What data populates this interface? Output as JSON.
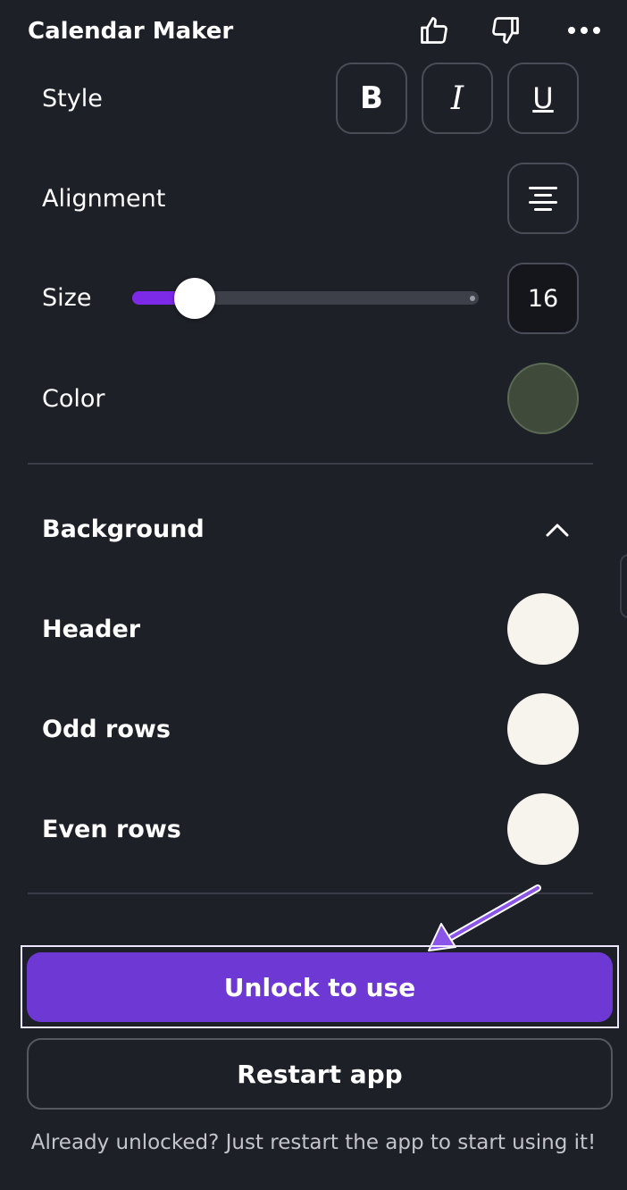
{
  "app": {
    "title": "Calendar Maker"
  },
  "header": {
    "icons": [
      "thumbs-up-icon",
      "thumbs-down-icon",
      "more-icon"
    ]
  },
  "text_settings": {
    "style_label": "Style",
    "style_buttons": {
      "bold": "B",
      "italic": "I",
      "underline": "U"
    },
    "alignment_label": "Alignment",
    "alignment_icon": "align-center-icon",
    "size_label": "Size",
    "size_value": "16",
    "size_slider_fraction": 0.18,
    "color_label": "Color",
    "color_value": "#3f4a3b"
  },
  "background": {
    "section_title": "Background",
    "collapse_icon": "chevron-up-icon",
    "header_label": "Header",
    "header_color": "#f7f4ee",
    "odd_rows_label": "Odd rows",
    "odd_rows_color": "#f7f4ee",
    "even_rows_label": "Even rows",
    "even_rows_color": "#f7f4ee"
  },
  "actions": {
    "unlock_label": "Unlock to use",
    "restart_label": "Restart app",
    "footnote": "Already unlocked? Just restart the app to start using it!"
  },
  "colors": {
    "accent": "#7d2ae8",
    "unlock_button": "#6e38d4",
    "background": "#1e2028"
  }
}
